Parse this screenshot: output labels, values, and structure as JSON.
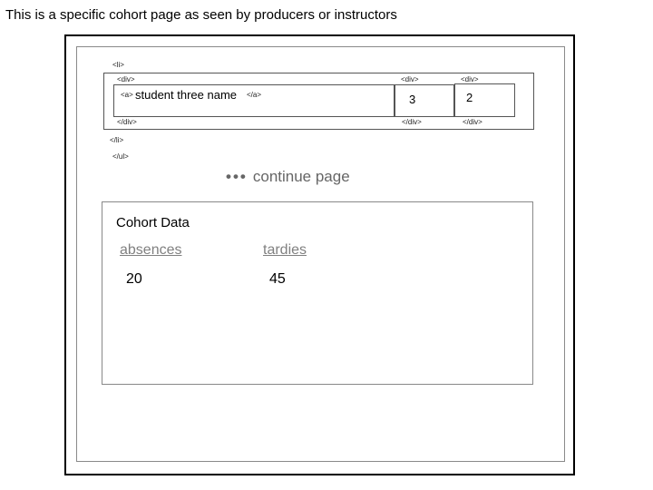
{
  "caption": "This is a specific cohort page as seen by producers or instructors",
  "student_list": {
    "li_open": "<li>",
    "row_div_open": "<div>",
    "col_div1_open": "<div>",
    "col_div2_open": "<div>",
    "anchor_open": "<a>",
    "student_name": "student three name",
    "anchor_close": "</a>",
    "value_1": "3",
    "value_2": "2",
    "row_div_close": "</div>",
    "col_div1_close": "</div>",
    "col_div2_close": "</div>",
    "li_close": "</li>",
    "ul_close": "</ul>"
  },
  "continue_text": "continue page",
  "cohort_data": {
    "title": "Cohort Data",
    "columns": [
      {
        "header": "absences",
        "value": "20"
      },
      {
        "header": "tardies",
        "value": "45"
      }
    ]
  }
}
